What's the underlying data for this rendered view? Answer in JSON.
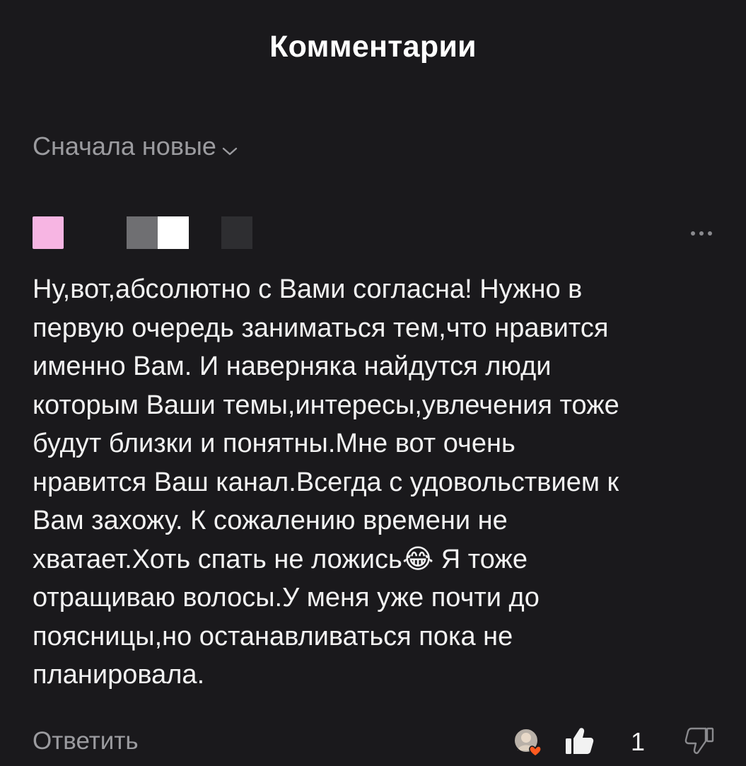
{
  "header": {
    "title": "Комментарии"
  },
  "sort": {
    "label": "Сначала новые",
    "icon": "chevron-down-icon"
  },
  "comment": {
    "author_avatar_color": "#f7b5e3",
    "text": "Ну,вот,абсолютно с Вами согласна! Нужно в\nпервую очередь заниматься тем,что нравится\nименно Вам. И наверняка найдутся люди\nкоторым Ваши темы,интересы,увлечения тоже\nбудут близки и понятны.Мне вот очень\nнравится Ваш канал.Всегда с удовольствием к\nВам захожу. К сожалению времени не\nхватает.Хоть спать не ложись😂 Я тоже\nотращиваю волосы.У меня уже почти до\nпоясницы,но останавливаться пока не\nпланировала.",
    "reply_label": "Ответить",
    "like_count": "1",
    "icons": {
      "more": "more-dots-icon",
      "author_heart": "author-heart-icon",
      "like": "thumbs-up-icon",
      "dislike": "thumbs-down-icon"
    }
  },
  "colors": {
    "background": "#1a191c",
    "text": "#f2f2f2",
    "muted": "#9b9b9f",
    "heart": "#ff5a1f"
  }
}
